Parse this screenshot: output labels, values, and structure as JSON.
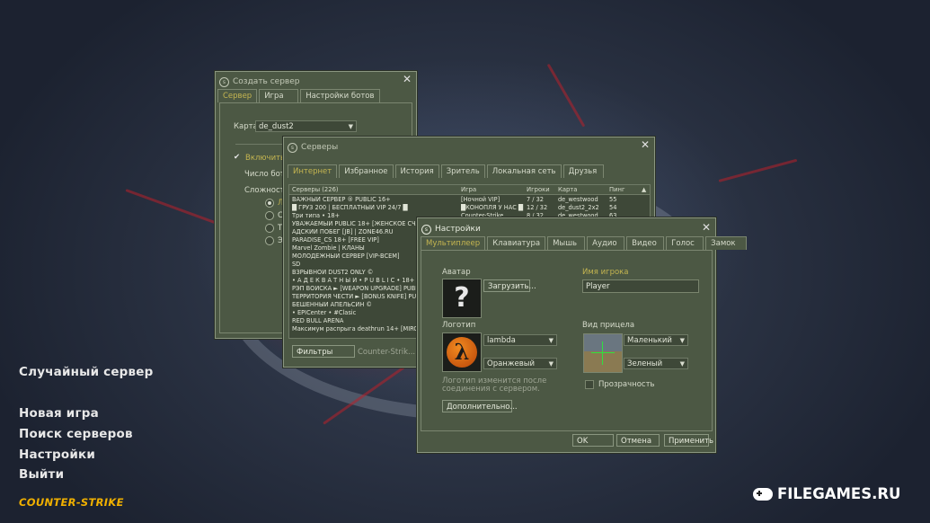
{
  "main_menu": {
    "random_server": "Случайный сервер",
    "new_game": "Новая игра",
    "find_servers": "Поиск серверов",
    "settings": "Настройки",
    "quit": "Выйти",
    "logo_text": "COUNTER-STRIKE"
  },
  "watermark": "FILEGAMES.RU",
  "create_server": {
    "title": "Создать сервер",
    "tabs": [
      "Сервер",
      "Игра",
      "Настройки ботов"
    ],
    "map_label": "Карта",
    "map_value": "de_dust2",
    "enable_bots_label": "Включить б",
    "bot_count_label": "Число боты",
    "difficulty_label": "Сложность",
    "difficulty_options": [
      "Л",
      "С",
      "Т",
      "Э"
    ]
  },
  "servers": {
    "title": "Серверы",
    "tabs": [
      "Интернет",
      "Избранное",
      "История",
      "Зритель",
      "Локальная сеть",
      "Друзья"
    ],
    "columns": {
      "name": "Серверы (226)",
      "game": "Игра",
      "players": "Игроки",
      "map": "Карта",
      "ping": "Пинг"
    },
    "rows": [
      {
        "name": "ВАЖНЫЙ СЕРВЕР ® PUBLIC 16+",
        "game": "[Ночной VIP]",
        "players": "7 / 32",
        "map": "de_westwood",
        "ping": "55"
      },
      {
        "name": "█ ГРУЗ 200 | БЕСПЛАТНЫЙ VIP 24/7 █",
        "game": "█КОНОПЛЯ У НАС █",
        "players": "12 / 32",
        "map": "de_dust2_2x2",
        "ping": "54"
      },
      {
        "name": "Три типа • 18+",
        "game": "Counter-Strike",
        "players": "8 / 32",
        "map": "de_westwood",
        "ping": "63"
      },
      {
        "name": "УВАЖАЕМЫЙ PUBLIC 18+ [ЖЕНСКОЕ СЧАСТ",
        "game": "",
        "players": "",
        "map": "",
        "ping": ""
      },
      {
        "name": "АДСКИЙ ПОБЕГ [JB] | ZONE46.RU",
        "game": "",
        "players": "",
        "map": "",
        "ping": ""
      },
      {
        "name": "PARADISE_CS 18+ [FREE VIP]",
        "game": "",
        "players": "",
        "map": "",
        "ping": ""
      },
      {
        "name": "Marvel Zombie | КЛАНЫ",
        "game": "",
        "players": "",
        "map": "",
        "ping": ""
      },
      {
        "name": "МОЛОДЁЖНЫЙ СЕРВЕР [VIP-ВСЕМ]",
        "game": "",
        "players": "",
        "map": "",
        "ping": ""
      },
      {
        "name": "SD",
        "game": "",
        "players": "",
        "map": "",
        "ping": ""
      },
      {
        "name": "ВЗРЫВНОЙ DUST2 ONLY ©",
        "game": "",
        "players": "",
        "map": "",
        "ping": ""
      },
      {
        "name": "• А Д Е К В А Т Н Ы Й • P U B L I C • 18+",
        "game": "",
        "players": "",
        "map": "",
        "ping": ""
      },
      {
        "name": "РЭП ВОЙСКА ► [WEAPON UPGRADE] PUBLIC",
        "game": "",
        "players": "",
        "map": "",
        "ping": ""
      },
      {
        "name": "ТЕРРИТОРИЯ ЧЕСТИ ► [BONUS KNIFE] PUBL",
        "game": "",
        "players": "",
        "map": "",
        "ping": ""
      },
      {
        "name": "БЕШЕННЫЙ АПЕЛЬСИН ©",
        "game": "",
        "players": "",
        "map": "",
        "ping": ""
      },
      {
        "name": "• EPICenter • #Clasic",
        "game": "",
        "players": "",
        "map": "",
        "ping": ""
      },
      {
        "name": "RED BULL ARENA",
        "game": "",
        "players": "",
        "map": "",
        "ping": ""
      },
      {
        "name": "Максимум распрыга deathrun 14+ [MIRCS.RU]",
        "game": "",
        "players": "",
        "map": "",
        "ping": ""
      }
    ],
    "filters_button": "Фильтры",
    "filter_game": "Counter-Strik..."
  },
  "settings": {
    "title": "Настройки",
    "tabs": [
      "Мультиплеер",
      "Клавиатура",
      "Мышь",
      "Аудио",
      "Видео",
      "Голос",
      "Замок"
    ],
    "avatar_label": "Аватар",
    "avatar_placeholder": "?",
    "upload_button": "Загрузить...",
    "player_name_label": "Имя игрока",
    "player_name_value": "Player",
    "logo_label": "Логотип",
    "logo_value": "lambda",
    "logo_color": "Оранжевый",
    "logo_glyph": "λ",
    "logo_note": "Логотип изменится после соединения с сервером.",
    "advanced_button": "Дополнительно...",
    "crosshair_label": "Вид прицела",
    "crosshair_size": "Маленький",
    "crosshair_color": "Зеленый",
    "transparency_label": "Прозрачность",
    "ok_button": "OK",
    "cancel_button": "Отмена",
    "apply_button": "Применить"
  },
  "colors": {
    "window_bg": "#4c5844",
    "selected_tab_text": "#c4b550",
    "field_bg": "#3e4838",
    "logo_gold": "#f0b000"
  }
}
